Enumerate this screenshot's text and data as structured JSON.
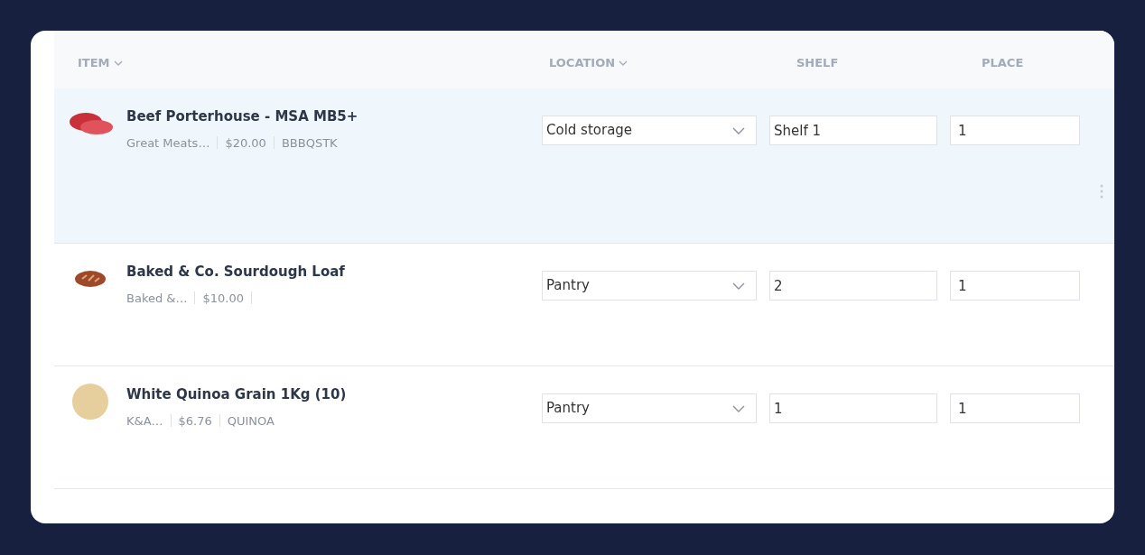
{
  "columns": [
    {
      "label": "ITEM",
      "sortable": true
    },
    {
      "label": "LOCATION",
      "sortable": true
    },
    {
      "label": "SHELF",
      "sortable": false
    },
    {
      "label": "PLACE",
      "sortable": false
    }
  ],
  "rows": [
    {
      "kind": "meat",
      "name": "Beef Porterhouse - MSA MB5+",
      "supplier": "Great Meats…",
      "price": "$20.00",
      "code": "BBBQSTK",
      "location": "Cold storage",
      "shelf": "Shelf 1",
      "place": "1",
      "selected": true
    },
    {
      "kind": "bread",
      "name": "Baked & Co. Sourdough Loaf",
      "supplier": "Baked &…",
      "price": "$10.00",
      "location": "Pantry",
      "shelf": "2",
      "place": "1",
      "selected": false
    },
    {
      "kind": "grain",
      "name": "White Quinoa Grain 1Kg (10)",
      "supplier": "K&A…",
      "price": "$6.76",
      "code": "QUINOA",
      "location": "Pantry",
      "shelf": "1",
      "place": "1",
      "selected": false
    }
  ]
}
